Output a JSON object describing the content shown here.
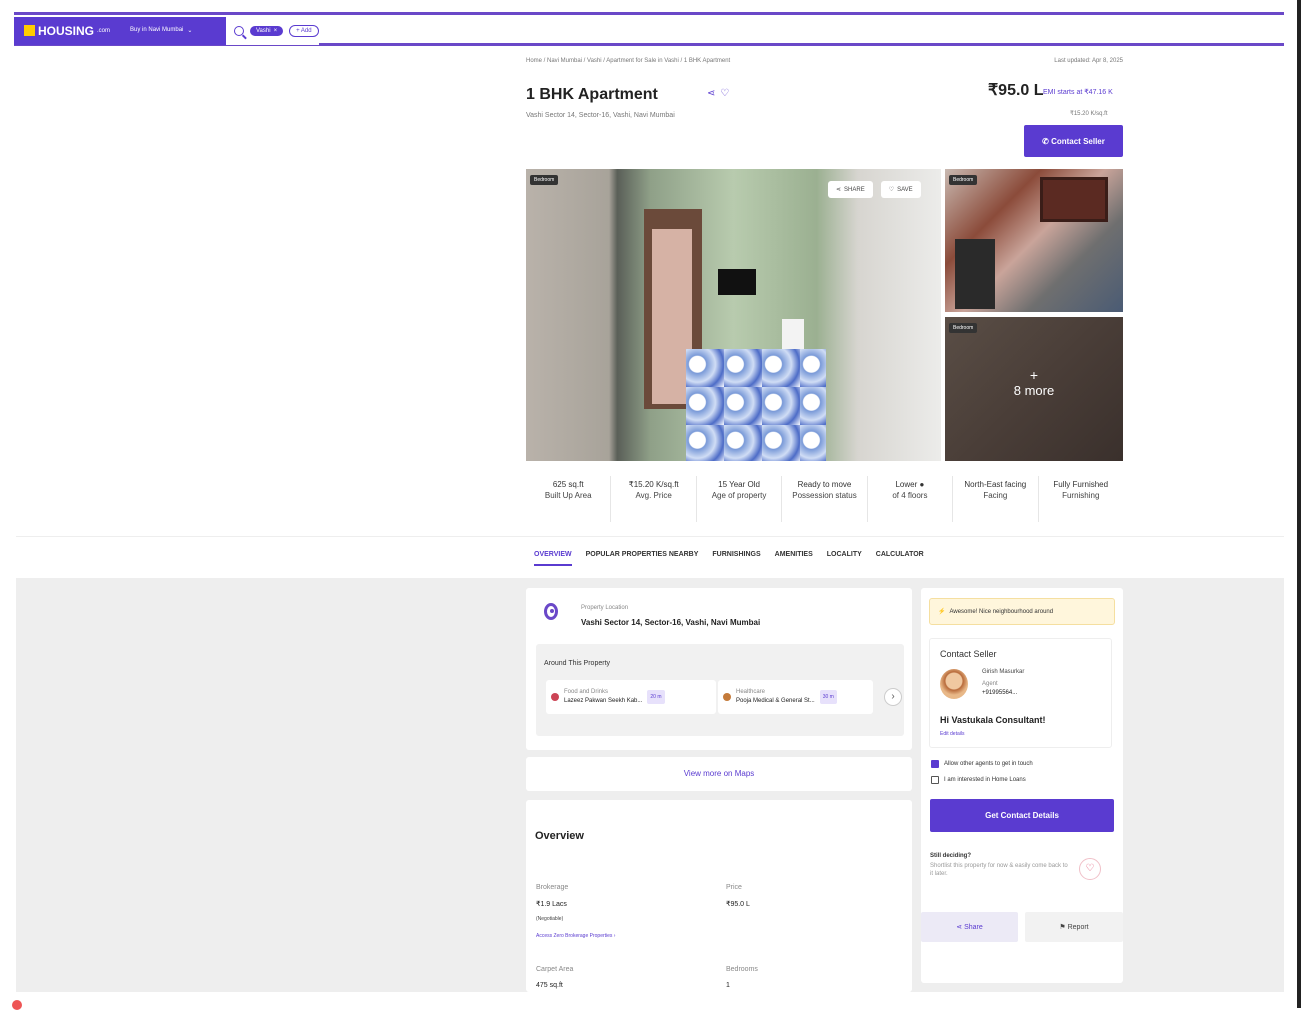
{
  "nav": {
    "logo": "HOUSING",
    "logo_sub": ".com",
    "city_dropdown": "Buy in Navi Mumbai",
    "search_chip": "Vashi",
    "search_chip_close": "×",
    "add_chip": "+ Add"
  },
  "breadcrumb": "Home / Navi Mumbai / Vashi / Apartment for Sale in Vashi / 1 BHK Apartment",
  "last_updated": "Last updated: Apr 8, 2025",
  "listing": {
    "title": "1 BHK Apartment",
    "address": "Vashi Sector 14, Sector-16, Vashi, Navi Mumbai",
    "price": "₹95.0 L",
    "emi": "EMI starts at ₹47.16 K",
    "price_per_sqft": "₹15.20 K/sq.ft",
    "contact_button": "Contact Seller"
  },
  "gallery": {
    "main_tag": "Bedroom",
    "share_label": "SHARE",
    "save_label": "SAVE",
    "top_right_tag": "Bedroom",
    "bottom_right_tag": "Bedroom",
    "more_plus": "+",
    "more_label": "8 more"
  },
  "stats": [
    {
      "value": "625 sq.ft",
      "label": "Built Up Area"
    },
    {
      "value": "₹15.20 K/sq.ft",
      "label": "Avg. Price"
    },
    {
      "value": "15 Year Old",
      "label": "Age of property"
    },
    {
      "value": "Ready to move",
      "label": "Possession status"
    },
    {
      "value": "Lower",
      "label": "of 4 floors"
    },
    {
      "value": "North-East facing",
      "label": "Facing"
    },
    {
      "value": "Fully Furnished",
      "label": "Furnishing"
    }
  ],
  "tabs": [
    "OVERVIEW",
    "POPULAR PROPERTIES NEARBY",
    "FURNISHINGS",
    "AMENITIES",
    "LOCALITY",
    "CALCULATOR"
  ],
  "location": {
    "label": "Property Location",
    "value": "Vashi Sector 14, Sector-16, Vashi, Navi Mumbai",
    "around_title": "Around This Property",
    "poi": [
      {
        "category": "Food and Drinks",
        "name": "Lazeez Pakwan Seekh Kab...",
        "distance": "20 m"
      },
      {
        "category": "Healthcare",
        "name": "Pooja Medical & General St...",
        "distance": "30 m"
      }
    ],
    "maps_link": "View more on Maps"
  },
  "overview": {
    "title": "Overview",
    "brokerage_label": "Brokerage",
    "brokerage_value": "₹1.9 Lacs",
    "brokerage_note": "(Negotiable)",
    "brokerage_link": "Access Zero Brokerage Properties ›",
    "price_label": "Price",
    "price_value": "₹95.0 L",
    "carpet_label": "Carpet Area",
    "carpet_value": "475 sq.ft",
    "bedrooms_label": "Bedrooms",
    "bedrooms_value": "1"
  },
  "sidebar": {
    "neighbourhood": "Awesome! Nice neighbourhood around",
    "contact_title": "Contact Seller",
    "agent_name": "Girish Masurkar",
    "agent_role": "Agent",
    "agent_phone": "+91995564...",
    "agent_message": "Hi Vastukala Consultant!",
    "edit_details": "Edit details",
    "check_agents": "Allow other agents to get in touch",
    "check_loans": "I am interested in Home Loans",
    "get_contact": "Get Contact Details",
    "still_deciding": "Still deciding?",
    "still_sub": "Shortlist this property for now & easily come back to it later.",
    "share": "Share",
    "report": "Report"
  }
}
